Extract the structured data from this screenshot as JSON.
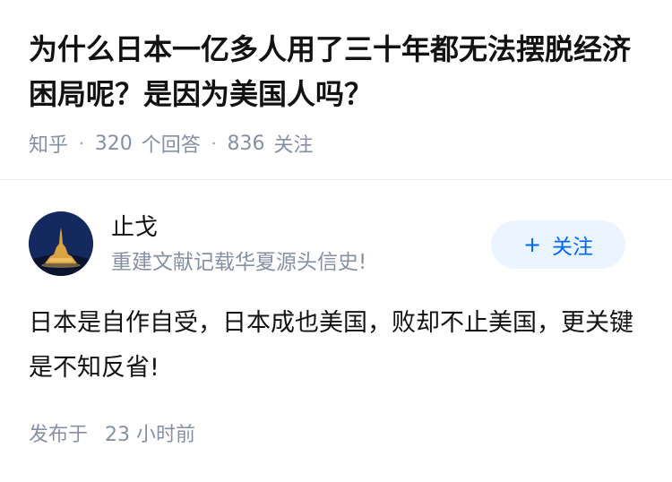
{
  "question": {
    "title": "为什么日本一亿多人用了三十年都无法摆脱经济困局呢？是因为美国人吗？",
    "source": "知乎",
    "separator": "·",
    "answer_count": "320",
    "answer_label": "个回答",
    "follower_count": "836",
    "follower_label": "关注"
  },
  "author": {
    "name": "止戈",
    "bio": "重建文献记载华夏源头信史!",
    "avatar_icon": "night-castle-avatar"
  },
  "follow_button": {
    "plus": "+",
    "label": "关注"
  },
  "answer": {
    "content": "日本是自作自受，日本成也美国，败却不止美国，更关键是不知反省!",
    "published_label": "发布于",
    "published_value": "23 小时前"
  },
  "colors": {
    "primary": "#0066ff",
    "muted": "#8590a6",
    "button_bg": "#ebf5ff",
    "text": "#121212"
  }
}
